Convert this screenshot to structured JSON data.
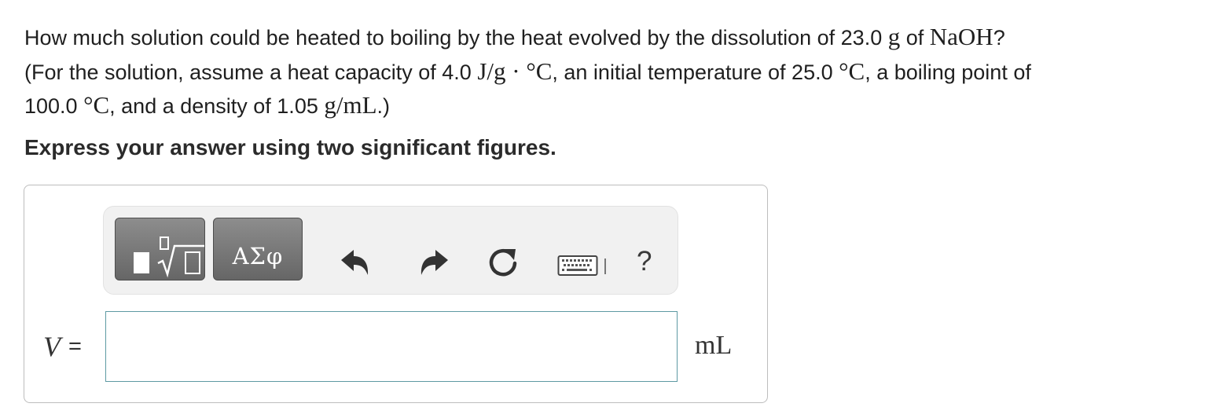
{
  "question": {
    "line1": {
      "text1": "How much solution could be heated to boiling by the heat evolved by the dissolution of 23.0 ",
      "unit_g": "g",
      "text2": " of ",
      "compound": "NaOH",
      "text3": "?"
    },
    "line2": {
      "text1": "(For the solution, assume a heat capacity of 4.0 ",
      "heat_capacity_unit": "J/g · °C",
      "text2": ", an initial temperature of 25.0 ",
      "temp_unit_1": "°C",
      "text3": ", a boiling point of"
    },
    "line3": {
      "text1": "100.0 ",
      "temp_unit_2": "°C",
      "text2": ", and a density of 1.05 ",
      "density_unit": "g/mL",
      "text3": ".)"
    }
  },
  "instruction": "Express your answer using two significant figures.",
  "toolbar": {
    "templates_button": {
      "icon": "templates-icon"
    },
    "symbols_button": {
      "label": "ΑΣφ"
    },
    "undo": {
      "icon": "undo-icon"
    },
    "redo": {
      "icon": "redo-icon"
    },
    "reset": {
      "icon": "reset-icon"
    },
    "keyboard": {
      "icon": "keyboard-icon"
    },
    "help_label": "?"
  },
  "answer": {
    "variable": "V",
    "equals": "=",
    "value": "",
    "unit": "mL"
  },
  "colors": {
    "button_gray": "#777777",
    "toolbar_bg": "#f1f1f1",
    "input_border": "#5e9aa3",
    "panel_border": "#bdbdbd"
  }
}
